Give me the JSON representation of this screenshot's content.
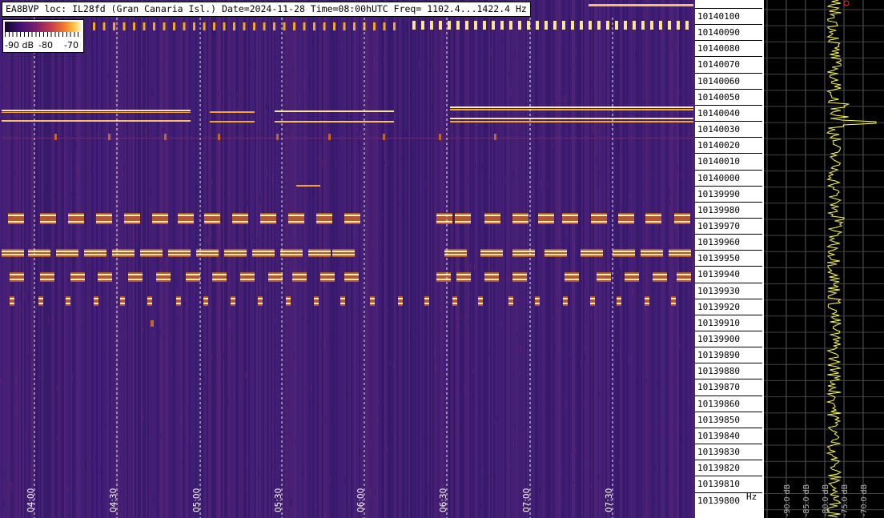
{
  "header": {
    "text": "EA8BVP loc: IL28fd (Gran Canaria Isl.) Date=2024-11-28 Time=08:00hUTC Freq= 1102.4...1422.4 Hz"
  },
  "legend": {
    "labels": [
      "-90 dB",
      "-80",
      "-70"
    ]
  },
  "freq_axis": {
    "ticks": [
      "10140100",
      "10140090",
      "10140080",
      "10140070",
      "10140060",
      "10140050",
      "10140040",
      "10140030",
      "10140020",
      "10140010",
      "10140000",
      "10139990",
      "10139980",
      "10139970",
      "10139960",
      "10139950",
      "10139940",
      "10139930",
      "10139920",
      "10139910",
      "10139900",
      "10139890",
      "10139880",
      "10139870",
      "10139860",
      "10139850",
      "10139840",
      "10139830",
      "10139820",
      "10139810",
      "10139800"
    ],
    "unit": "Hz"
  },
  "time_axis": {
    "labels": [
      "04:00",
      "04:30",
      "05:00",
      "05:30",
      "06:00",
      "06:30",
      "07:00",
      "07:30"
    ]
  },
  "spectrum": {
    "db_labels": [
      "-90.0 dB",
      "-85.0 dB",
      "-80.0 dB",
      "-75.0 dB",
      "-70.0 dB"
    ]
  },
  "colors": {
    "background": "#3a1c6e",
    "signal_hot": "#fff2b0",
    "signal_warm": "#f5a623",
    "spectrum_trace": "#ffff40",
    "grid": "#555555"
  }
}
